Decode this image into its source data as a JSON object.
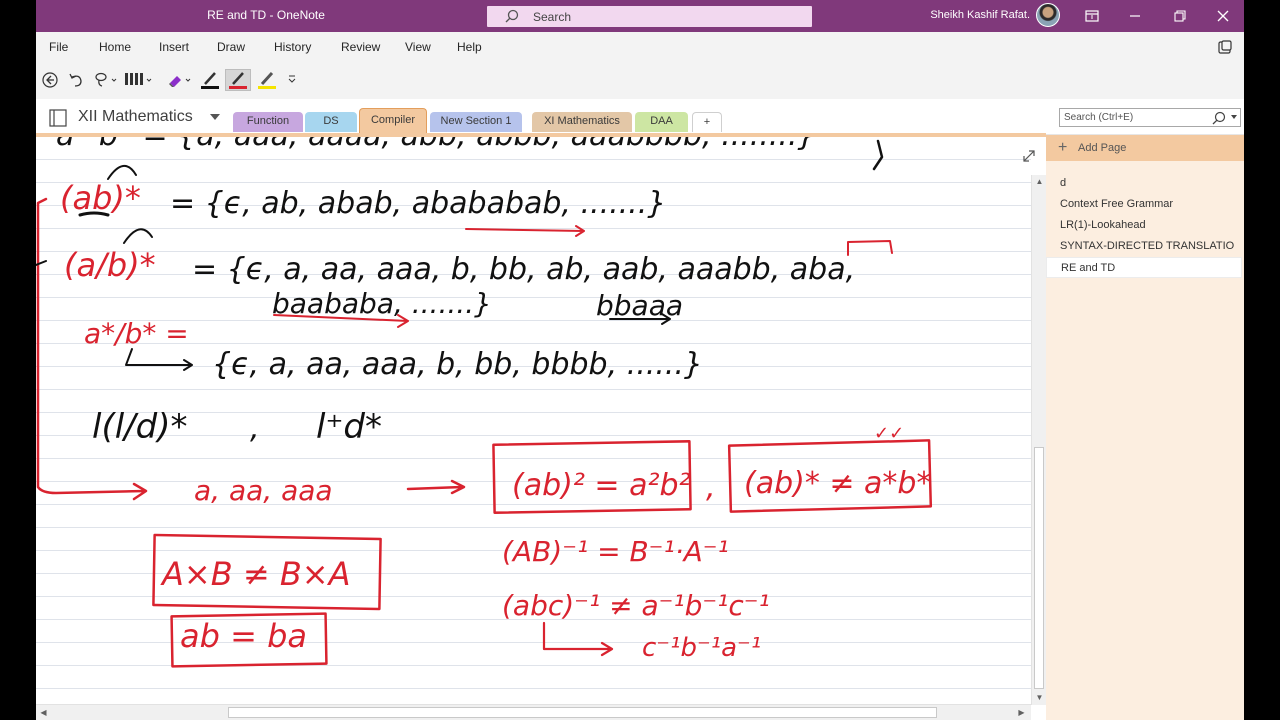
{
  "window": {
    "title": "RE and TD  -  OneNote",
    "search_label": "Search",
    "user_name": "Sheikh Kashif Rafat."
  },
  "menu": {
    "items": [
      {
        "label": "File"
      },
      {
        "label": "Home"
      },
      {
        "label": "Insert"
      },
      {
        "label": "Draw"
      },
      {
        "label": "History"
      },
      {
        "label": "Review"
      },
      {
        "label": "View"
      },
      {
        "label": "Help"
      }
    ]
  },
  "notebook": {
    "name": "XII Mathematics",
    "sections": [
      {
        "label": "Function",
        "color": "#c7a7df"
      },
      {
        "label": "DS",
        "color": "#a7d6ef"
      },
      {
        "label": "Compiler",
        "color": "#f3c9a0"
      },
      {
        "label": "New Section 1",
        "color": "#b6c3ec"
      },
      {
        "label": "XI Mathematics",
        "color": "#e3c7a7"
      },
      {
        "label": "DAA",
        "color": "#cde6a3"
      }
    ],
    "active_section": "Compiler",
    "add_section_label": "+",
    "search_placeholder": "Search (Ctrl+E)"
  },
  "pages": {
    "add_page_label": "Add Page",
    "items": [
      {
        "label": "d"
      },
      {
        "label": "Context Free Grammar"
      },
      {
        "label": "LR(1)-Lookahead"
      },
      {
        "label": "SYNTAX-DIRECTED TRANSLATIO"
      },
      {
        "label": "RE and TD"
      }
    ],
    "active_page": "RE and TD"
  },
  "ink": {
    "line1": "a* b* = {a, aaa, aaaa, abb, abbb, aaabbbb, ........}",
    "line2_lhs": "(ab)*",
    "line2_rhs": "= {ϵ, ab, abab, abababab, .......}",
    "line3_lhs": "(a/b)*",
    "line3_rhs": "= {ϵ, a, aa, aaa, b, bb, ab, aab, aaabb, aba,",
    "line4": "baababa, .......}",
    "line4_note": "bbaaa",
    "line5_lhs": "a*/b* =",
    "line5_rhs": "{ϵ, a, aa, aaa, b, bb, bbbb, ......}",
    "line6a": "l(l/d)*",
    "line6b": ",",
    "line6c": "l⁺d*",
    "line7a": "a, aa, aaa",
    "box1": "(ab)² = a²b²",
    "comma": ",",
    "box2": "(ab)* ≠ a*b*",
    "check": "✓✓",
    "eq1": "(AB)⁻¹ = B⁻¹·A⁻¹",
    "box3": "A×B ≠ B×A",
    "box4": "ab = ba",
    "eq2": "(abc)⁻¹ ≠ a⁻¹b⁻¹c⁻¹",
    "eq3": "c⁻¹b⁻¹a⁻¹"
  },
  "colors": {
    "accent": "#80397b",
    "section_orange": "#f3c9a0",
    "ink_black": "#111111",
    "ink_red": "#d9232f"
  }
}
